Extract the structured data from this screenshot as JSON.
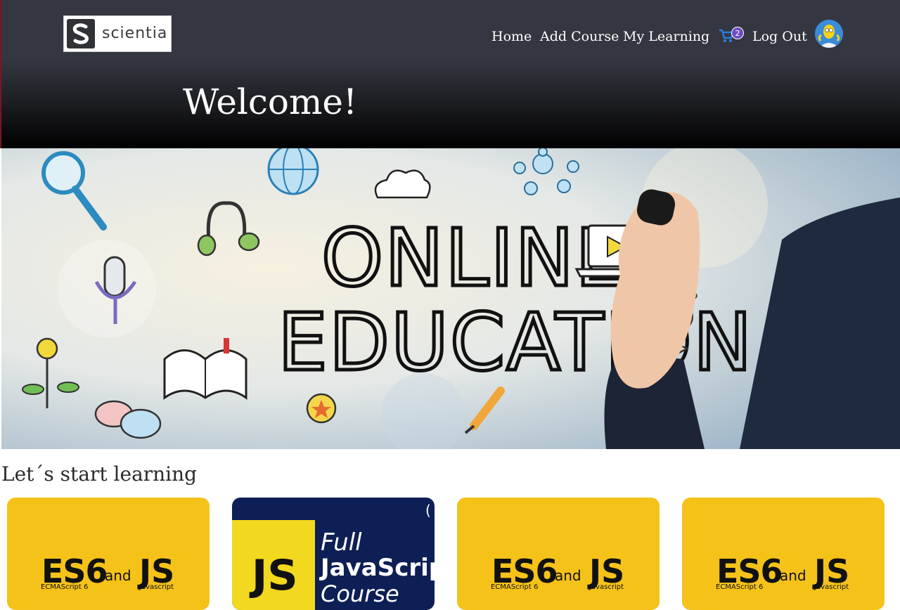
{
  "brand": {
    "name": "scientia",
    "mark": "S"
  },
  "nav": {
    "items": [
      "Home",
      "Add Course",
      "My Learning"
    ],
    "cart_count": "2",
    "logout": "Log Out"
  },
  "header": {
    "welcome": "Welcome!"
  },
  "hero": {
    "line1": "ONLINE",
    "line2": "EDUCATION"
  },
  "section": {
    "title": "Let´s start learning"
  },
  "courses": [
    {
      "big_left": "ES6",
      "and": "and",
      "big_right": "JS",
      "sub_left": "ECMAScript 6",
      "sub_right": "Javascript"
    },
    {
      "badge": "JS",
      "line1": "Full",
      "line2": "JavaScrip",
      "line3": "Course",
      "corner": "("
    },
    {
      "big_left": "ES6",
      "and": "and",
      "big_right": "JS",
      "sub_left": "ECMAScript 6",
      "sub_right": "Javascript"
    },
    {
      "big_left": "ES6",
      "and": "and",
      "big_right": "JS",
      "sub_left": "ECMAScript 6",
      "sub_right": "Javascript"
    }
  ],
  "colors": {
    "accent_yellow": "#f5c21a",
    "header_dark": "#343741",
    "cart_blue": "#2a7de1",
    "badge_purple": "#6f4cc4"
  },
  "icons": [
    "cart-icon",
    "user-avatar"
  ]
}
